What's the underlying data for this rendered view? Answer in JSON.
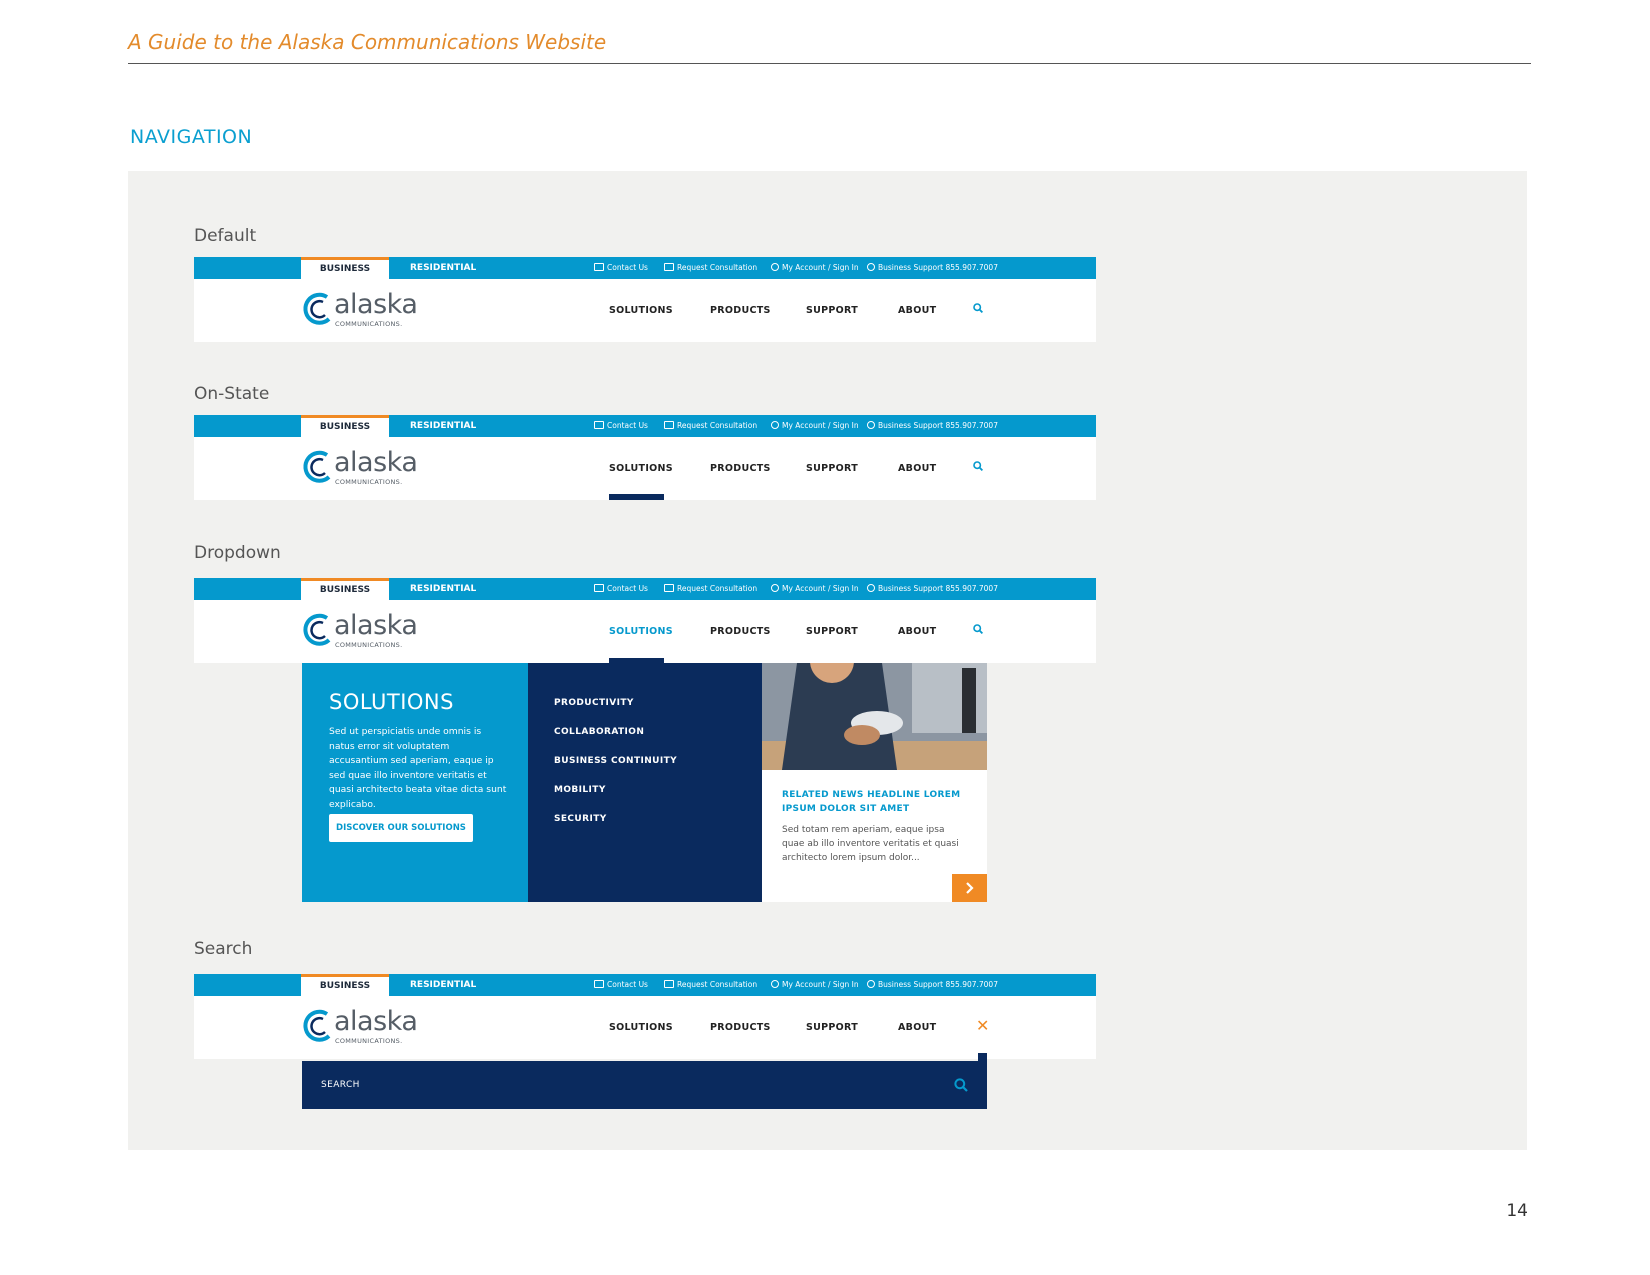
{
  "document": {
    "title": "A Guide to the Alaska Communications Website",
    "section": "NAVIGATION",
    "page_number": "14"
  },
  "colors": {
    "accent_orange": "#f08a24",
    "brand_blue": "#0599cd",
    "navy": "#0a2a5e",
    "panel_bg": "#f1f1ef"
  },
  "header": {
    "tabs": {
      "business": "BUSINESS",
      "residential": "RESIDENTIAL"
    },
    "utility": {
      "contact": "Contact Us",
      "consultation": "Request Consultation",
      "account": "My Account / Sign In",
      "support": "Business Support  855.907.7007"
    },
    "logo": {
      "word": "alaska",
      "sub": "COMMUNICATIONS."
    },
    "nav": {
      "solutions": "SOLUTIONS",
      "products": "PRODUCTS",
      "support": "SUPPORT",
      "about": "ABOUT"
    }
  },
  "variants": {
    "default": "Default",
    "on_state": "On-State",
    "dropdown": "Dropdown",
    "search": "Search"
  },
  "dropdown": {
    "title": "SOLUTIONS",
    "body": "Sed ut perspiciatis unde omnis is natus error sit voluptatem accusantium sed aperiam, eaque ip sed quae illo inventore veritatis et quasi architecto beata vitae dicta sunt explicabo.",
    "cta": "DISCOVER OUR SOLUTIONS",
    "items": [
      "PRODUCTIVITY",
      "COLLABORATION",
      "BUSINESS CONTINUITY",
      "MOBILITY",
      "SECURITY"
    ],
    "news_headline": "RELATED NEWS HEADLINE LOREM IPSUM DOLOR SIT AMET",
    "news_text": "Sed totam rem aperiam, eaque ipsa quae ab illo inventore veritatis et quasi architecto lorem ipsum dolor..."
  },
  "search": {
    "label": "SEARCH"
  },
  "icons": {
    "search": "search-icon",
    "close": "close-icon",
    "next": "chevron-right-icon",
    "mail": "mail-icon",
    "chat": "chat-icon",
    "user": "user-icon",
    "phone": "phone-icon"
  }
}
